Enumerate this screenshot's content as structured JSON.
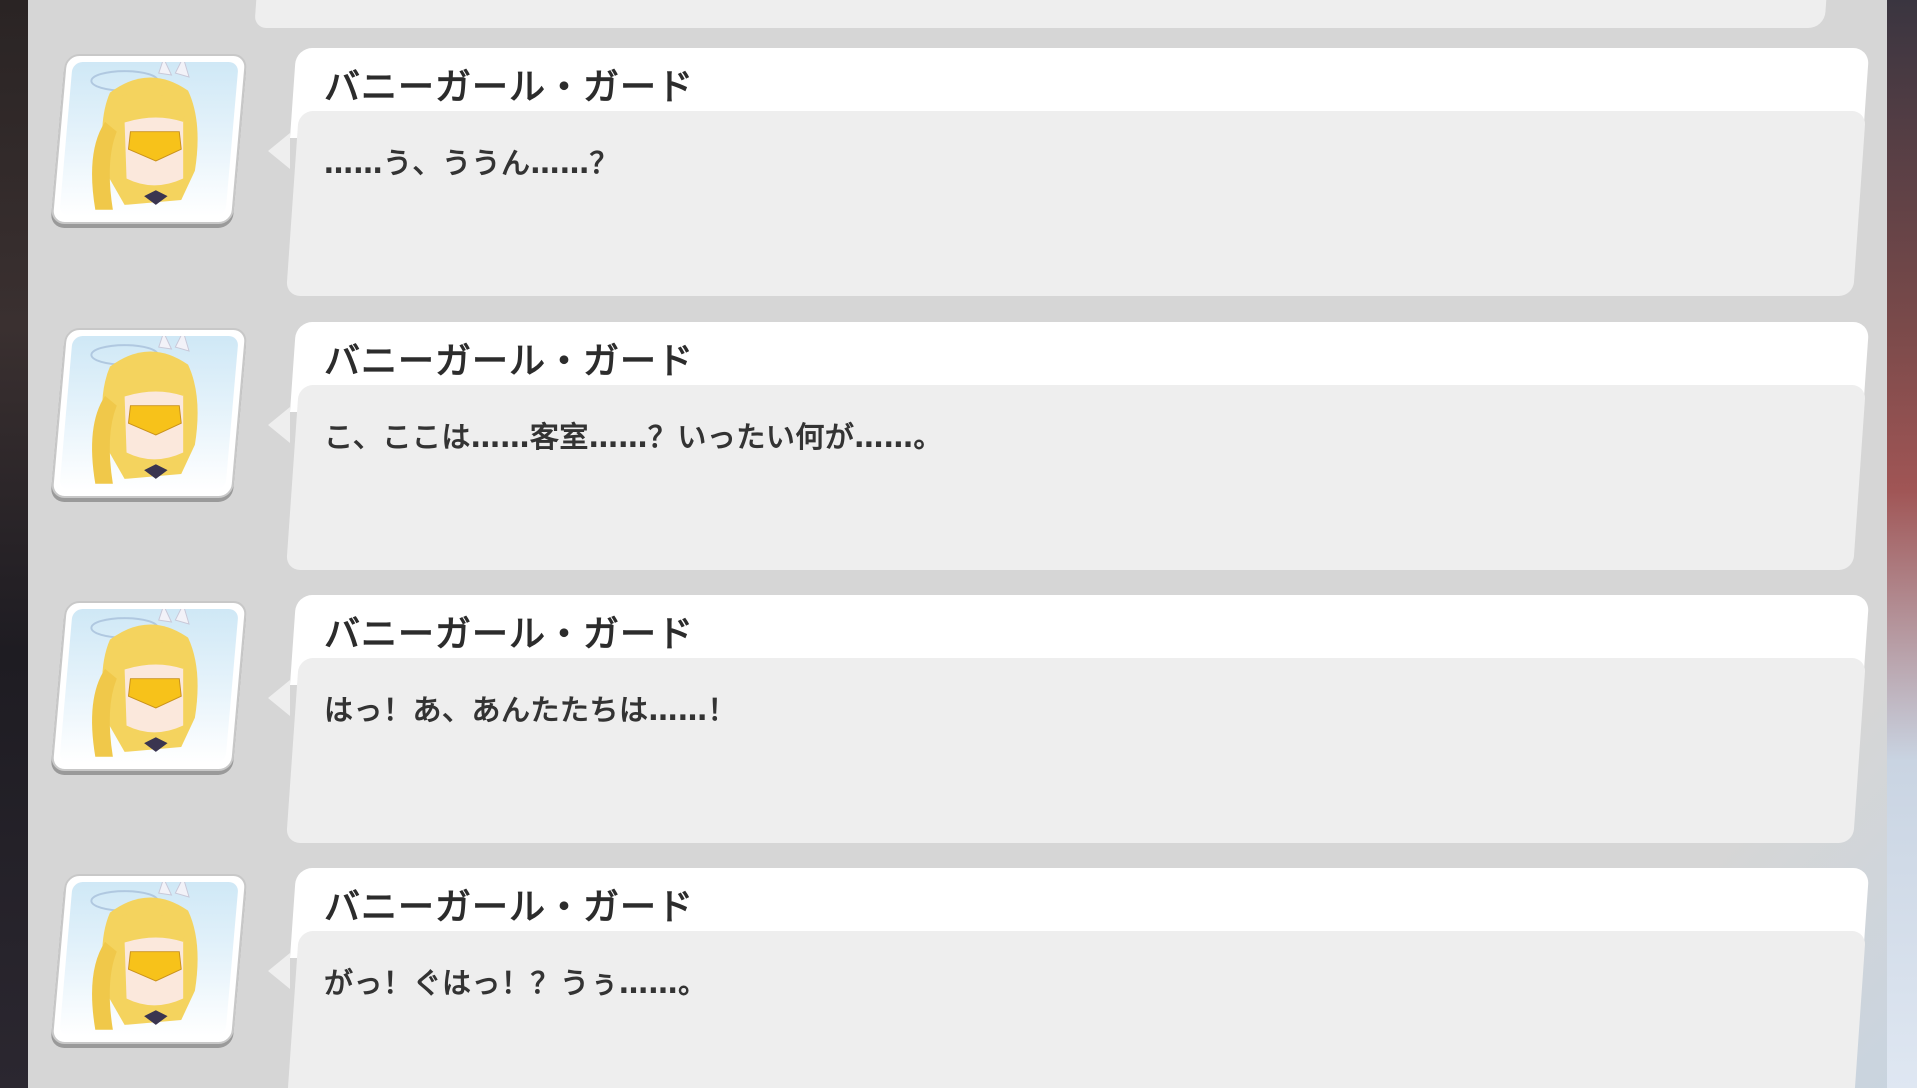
{
  "log": {
    "entries": [
      {
        "speaker": "バニーガール・ガード",
        "text": "……う、ううん……？"
      },
      {
        "speaker": "バニーガール・ガード",
        "text": "こ、ここは……客室……？いったい何が……。"
      },
      {
        "speaker": "バニーガール・ガード",
        "text": "はっ！あ、あんたたちは……！"
      },
      {
        "speaker": "バニーガール・ガード",
        "text": "がっ！ぐはっ！？うぅ……。"
      }
    ]
  },
  "colors": {
    "panel": "#d6d6d6",
    "bubble": "#eeeeee",
    "name_strip": "#ffffff",
    "text": "#333333"
  },
  "icons": {
    "avatar": "bunny-girl-guard-portrait"
  }
}
